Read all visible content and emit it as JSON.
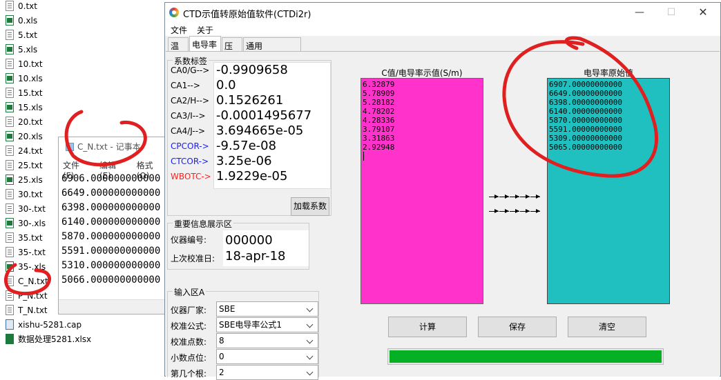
{
  "explorer": {
    "files": [
      {
        "name": "0.txt",
        "type": "txt"
      },
      {
        "name": "0.xls",
        "type": "xls"
      },
      {
        "name": "5.txt",
        "type": "txt"
      },
      {
        "name": "5.xls",
        "type": "xls"
      },
      {
        "name": "10.txt",
        "type": "txt"
      },
      {
        "name": "10.xls",
        "type": "xls"
      },
      {
        "name": "15.txt",
        "type": "txt"
      },
      {
        "name": "15.xls",
        "type": "xls"
      },
      {
        "name": "20.txt",
        "type": "txt"
      },
      {
        "name": "20.xls",
        "type": "xls"
      },
      {
        "name": "24.txt",
        "type": "txt"
      },
      {
        "name": "25.txt",
        "type": "txt"
      },
      {
        "name": "25.xls",
        "type": "xls"
      },
      {
        "name": "30.txt",
        "type": "txt"
      },
      {
        "name": "30-.txt",
        "type": "txt"
      },
      {
        "name": "30-.xls",
        "type": "xls"
      },
      {
        "name": "35.txt",
        "type": "txt"
      },
      {
        "name": "35-.txt",
        "type": "txt"
      },
      {
        "name": "35-.xls",
        "type": "xls"
      },
      {
        "name": "C_N.txt",
        "type": "txt"
      },
      {
        "name": "P_N.txt",
        "type": "txt"
      },
      {
        "name": "T_N.txt",
        "type": "txt"
      },
      {
        "name": "xishu-5281.cap",
        "type": "cap"
      },
      {
        "name": "数据处理5281.xlsx",
        "type": "xlsx"
      }
    ]
  },
  "notepad": {
    "title": "C_N.txt - 记事本",
    "menu": [
      "文件(F)",
      "编辑(E)",
      "格式(O)"
    ],
    "lines": [
      "6906.000000000000",
      "6649.000000000000",
      "6398.000000000000",
      "6140.000000000000",
      "5870.000000000000",
      "5591.000000000000",
      "5310.000000000000",
      "5066.000000000000"
    ]
  },
  "app": {
    "title": "CTD示值转原始值软件(CTDi2r)",
    "window_buttons": {
      "minimize": "—",
      "maximize": "☐",
      "close": "✕"
    },
    "menu": [
      "文件",
      "关于"
    ],
    "tabs": [
      "温度",
      "电导率",
      "压力",
      "通用Common"
    ],
    "active_tab": 1,
    "coefficients": {
      "group_title": "系数标签",
      "rows": [
        {
          "label": "CA0/G-->",
          "value": "-0.9909658",
          "color": "#000000"
        },
        {
          "label": "CA1-->",
          "value": "0.0",
          "color": "#000000"
        },
        {
          "label": "CA2/H-->",
          "value": "0.1526261",
          "color": "#000000"
        },
        {
          "label": "CA3/I-->",
          "value": "-0.0001495677",
          "color": "#000000"
        },
        {
          "label": "CA4/J-->",
          "value": "3.694665e-05",
          "color": "#000000"
        },
        {
          "label": "CPCOR->",
          "value": "-9.57e-08",
          "color": "#1a1aff"
        },
        {
          "label": "CTCOR->",
          "value": "3.25e-06",
          "color": "#1a1aff"
        },
        {
          "label": "WBOTC->",
          "value": "1.9229e-05",
          "color": "#ff2020"
        }
      ],
      "load_button": "加载系数"
    },
    "info": {
      "group_title": "重要信息展示区",
      "instrument_label": "仪器编号:",
      "instrument_value": "000000",
      "calib_label": "上次校准日:",
      "calib_value": "18-apr-18"
    },
    "input": {
      "group_title": "输入区A",
      "fields": [
        {
          "label": "仪器厂家:",
          "value": "SBE"
        },
        {
          "label": "校准公式:",
          "value": "SBE电导率公式1"
        },
        {
          "label": "校准点数:",
          "value": "8"
        },
        {
          "label": "小数点位:",
          "value": "0"
        },
        {
          "label": "第几个根:",
          "value": "2"
        }
      ]
    },
    "display_list": {
      "header": "C值/电导率示值(S/m)",
      "color": "#ff33cc",
      "values": [
        "6.32879",
        "5.78909",
        "5.28182",
        "4.78202",
        "4.28336",
        "3.79107",
        "3.31863",
        "2.92948"
      ]
    },
    "raw_list": {
      "header": "电导率原始值",
      "color": "#20c0c0",
      "values": [
        "6907.00000000000",
        "6649.00000000000",
        "6398.00000000000",
        "6140.00000000000",
        "5870.00000000000",
        "5591.00000000000",
        "5309.00000000000",
        "5065.00000000000"
      ]
    },
    "buttons": {
      "compute": "计算",
      "save": "保存",
      "clear": "清空"
    },
    "progress": 1.0,
    "progress_color": "#06b025"
  },
  "annotation_color": "#e02020"
}
